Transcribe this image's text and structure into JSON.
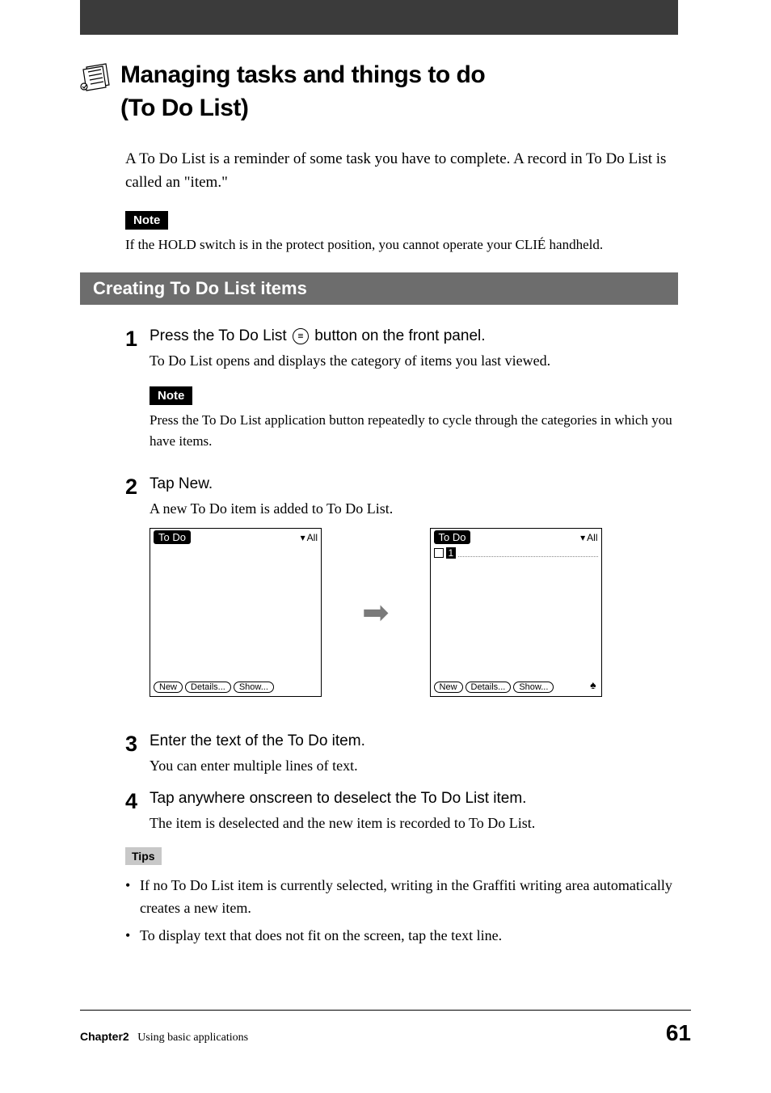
{
  "title_line1": "Managing tasks and things to do",
  "title_line2": "(To Do List)",
  "intro": "A To Do List is a reminder of some task you have to complete. A record in To Do List is called an \"item.\"",
  "note_label": "Note",
  "note1": "If the HOLD switch is in the protect position, you cannot operate your CLIÉ handheld.",
  "section_heading": "Creating To Do List items",
  "steps": {
    "s1": {
      "num": "1",
      "title_before": "Press the To Do List ",
      "title_after": " button on the front panel.",
      "desc": "To Do List opens and displays the category of items you last viewed.",
      "inner_note": "Press the To Do List application button repeatedly to cycle through the categories in which you have items."
    },
    "s2": {
      "num": "2",
      "title": "Tap New.",
      "desc": "A new To Do item is added to To Do List."
    },
    "s3": {
      "num": "3",
      "title": "Enter the text of the To Do item.",
      "desc": "You can enter multiple lines of text."
    },
    "s4": {
      "num": "4",
      "title": "Tap anywhere onscreen to deselect the To Do List item.",
      "desc": "The item is deselected and the new item is recorded to To Do List."
    }
  },
  "screens": {
    "tab": "To Do",
    "category": "All",
    "buttons": {
      "new": "New",
      "details1": "Details...",
      "details2": "Details...",
      "show": "Show..."
    },
    "priority": "1"
  },
  "tips_label": "Tips",
  "tips": {
    "t1": "If no To Do List item is currently selected, writing in the Graffiti writing area automatically creates a new item.",
    "t2": "To display text that does not fit on the screen, tap the text line."
  },
  "footer": {
    "chapter": "Chapter2",
    "subtitle": "Using basic applications",
    "page": "61"
  }
}
